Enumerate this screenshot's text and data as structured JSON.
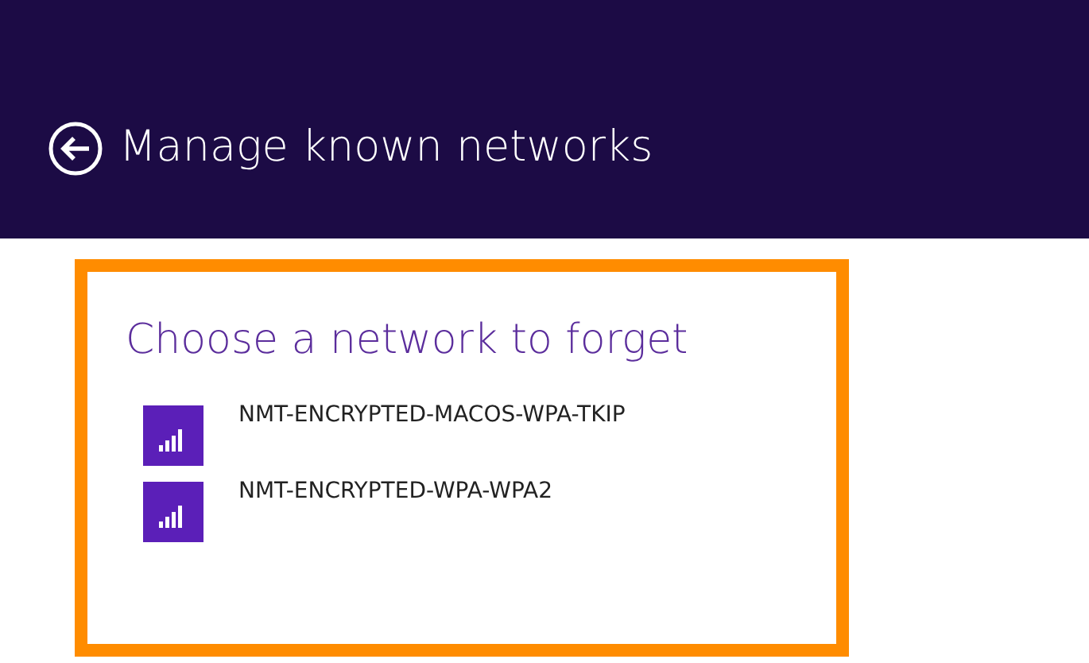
{
  "header": {
    "title": "Manage known networks"
  },
  "panel": {
    "heading": "Choose a network to forget",
    "networks": [
      {
        "name": "NMT-ENCRYPTED-MACOS-WPA-TKIP"
      },
      {
        "name": "NMT-ENCRYPTED-WPA-WPA2"
      }
    ]
  }
}
